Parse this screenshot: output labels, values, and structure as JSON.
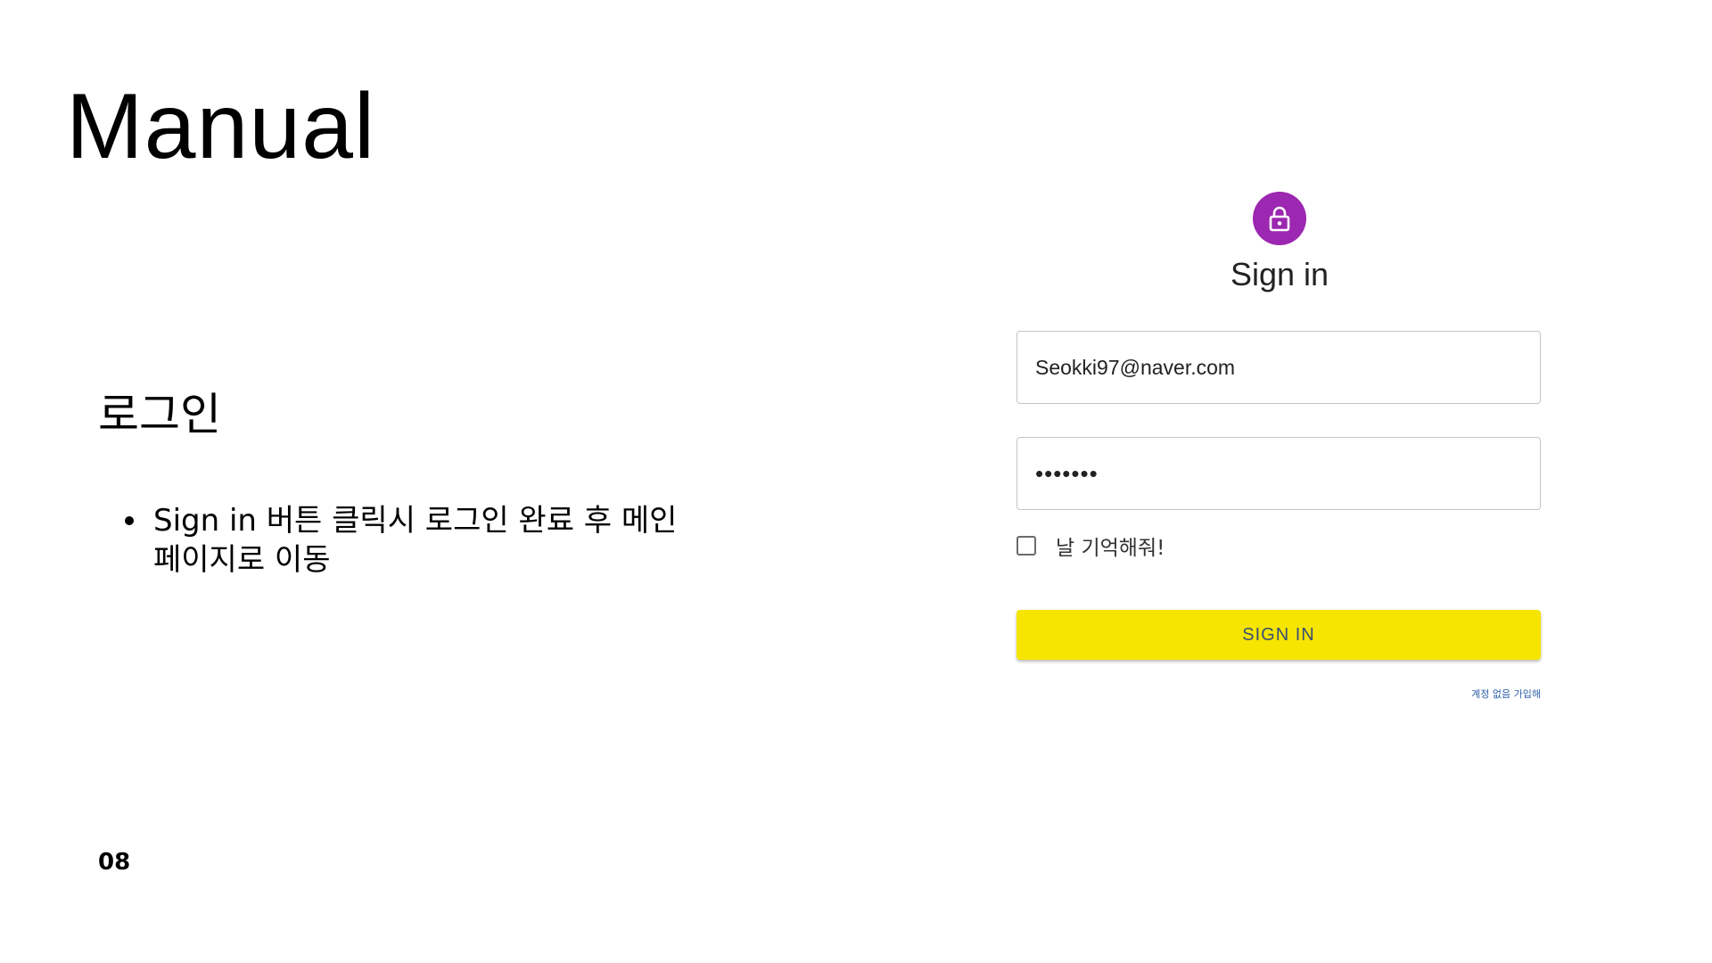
{
  "slide": {
    "title": "Manual",
    "section_heading": "로그인",
    "bullets": [
      "Sign in 버튼 클릭시 로그인 완료 후 메인 페이지로 이동"
    ],
    "page_number": "08"
  },
  "signin_form": {
    "avatar_icon": "lock-icon",
    "avatar_color": "#9c27b0",
    "title": "Sign in",
    "email_value": "Seokki97@naver.com",
    "password_value": "•••••••",
    "remember_label": "날 기억해줘!",
    "remember_checked": false,
    "button_label": "SIGN IN",
    "button_color": "#f5e500",
    "signup_link": "계정 없음 가입해"
  }
}
